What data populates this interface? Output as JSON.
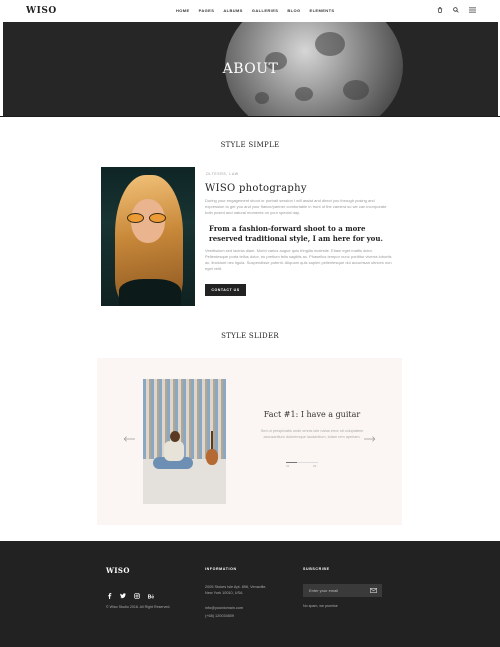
{
  "header": {
    "logo": "WISO",
    "nav": [
      "HOME",
      "PAGES",
      "ALBUMS",
      "GALLERIES",
      "BLOG",
      "ELEMENTS"
    ],
    "icons": [
      "cart-icon",
      "search-icon",
      "menu-icon"
    ]
  },
  "hero": {
    "title": "ABOUT"
  },
  "style_simple": {
    "section_title": "STYLE SIMPLE",
    "kicker": "OLTESRS, LAW",
    "title": "WISO photography",
    "paragraph1": "During your engagement shoot or portrait session I will assist and direct you through posing and expression to get you and your fiance/partner comfortable in front of the camera so we can incorporate both posed and natural moments on your special day.",
    "quote": "From a fashion-forward shoot to a more reserved traditional style, I am here for you.",
    "paragraph2": "Vestibulum sed lacinia diam. Morbi varius augue quis fringilla molestie. Etiam eget mattis dolor. Pellentesque porta tellus dolor, eu pretium felis sagittis ac. Phasellus tempor nunc porttitor viverra lobortis ac, tincidunt nec ligula. Suspendisse potenti. Aliquam quis sapien pellentesque dui accumsan ultrices non eget velit.",
    "button": "CONTACT US"
  },
  "style_slider": {
    "section_title": "STYLE SLIDER",
    "fact_title": "Fact #1: I have a guitar",
    "fact_text": "Sed ut perspiciatis unde omnis iste natus error sit voluptatem accusantium doloremque laudantium, totam rem aperiam.",
    "counter_current": "01",
    "counter_total": "03",
    "progress": 0.33
  },
  "footer": {
    "logo": "WISO",
    "socials": [
      "facebook-icon",
      "twitter-icon",
      "instagram-icon",
      "behance-icon"
    ],
    "copyright": "© Wiso Studio 2018. All Right Reserved.",
    "info_heading": "INFORMATION",
    "address_line1": "2005 Stokes Isle Apt. 896, Venaville,",
    "address_line2": "New York 10010, USA",
    "email": "info@yourdomain.com",
    "phone": "(+68) 120034509",
    "subscribe_heading": "SUBSCRIBE",
    "email_placeholder": "Enter your email",
    "spam_note": "No spam, we promise"
  },
  "colors": {
    "footer_bg": "#222222",
    "slider_bg": "#fbf6f3",
    "button_bg": "#222222"
  }
}
